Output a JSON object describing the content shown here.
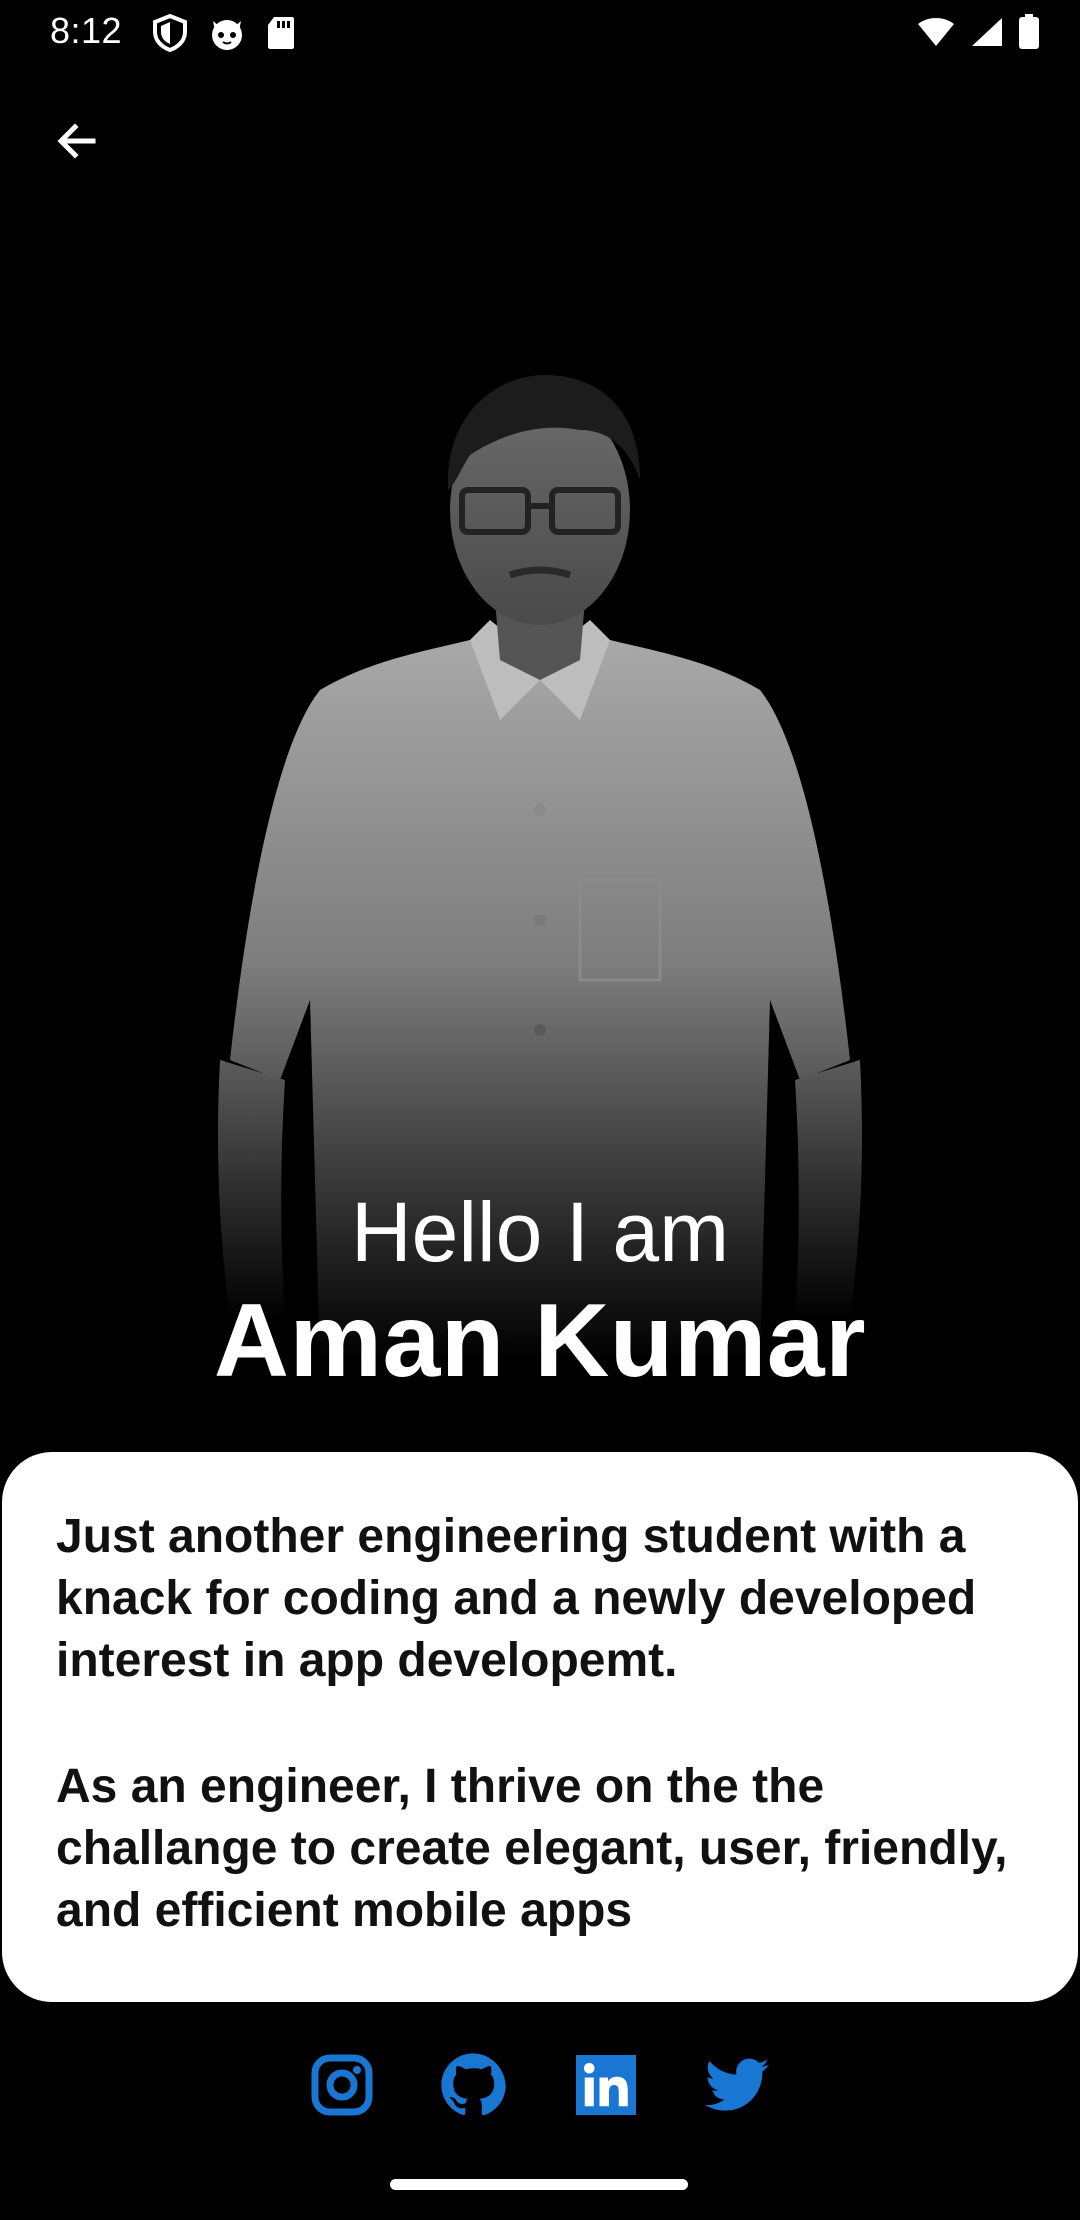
{
  "status_bar": {
    "time": "8:12",
    "left_icons": [
      "shield-icon",
      "cat-icon",
      "sd-card-icon"
    ],
    "right_icons": [
      "wifi-icon",
      "signal-icon",
      "battery-icon"
    ]
  },
  "header": {
    "back_icon": "arrow-left-icon"
  },
  "profile": {
    "greeting": "Hello I am",
    "name": "Aman Kumar",
    "portrait": "grayscale portrait photo"
  },
  "bio": {
    "paragraphs": [
      "Just another engineering student with a knack for coding and a newly developed interest in app developemt.",
      "As an engineer, I thrive on the the challange to create elegant, user, friendly, and efficient mobile apps"
    ]
  },
  "social": {
    "accent": "#1976D2",
    "links": [
      "instagram-icon",
      "github-icon",
      "linkedin-icon",
      "twitter-icon"
    ]
  },
  "colors": {
    "background": "#000000",
    "card": "#FFFFFF",
    "card_text": "#111111"
  }
}
